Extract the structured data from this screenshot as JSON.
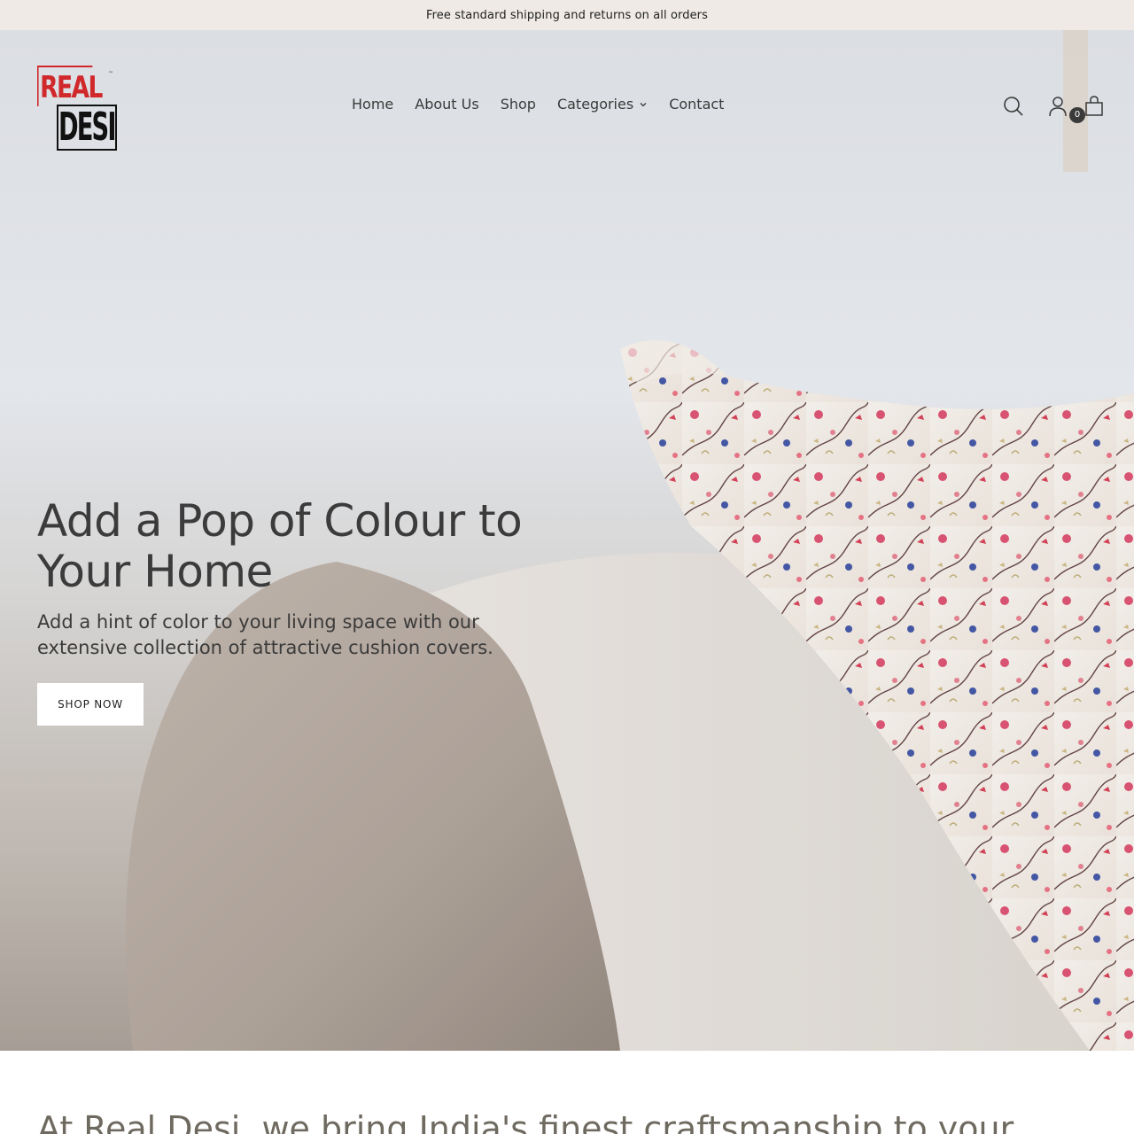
{
  "announcement": {
    "text": "Free standard shipping and returns on all orders"
  },
  "header": {
    "logo": {
      "line1": "REAL",
      "line2": "DESI",
      "mark": "™"
    },
    "nav": [
      {
        "label": "Home"
      },
      {
        "label": "About Us"
      },
      {
        "label": "Shop"
      },
      {
        "label": "Categories",
        "has_dropdown": true
      },
      {
        "label": "Contact"
      }
    ],
    "icons": [
      "search-icon",
      "account-icon",
      "cart-icon"
    ],
    "cart_count": "0"
  },
  "hero": {
    "title": "Add a Pop of Colour to Your Home",
    "subtitle": "Add a hint of color to your living space with our extensive collection of attractive cushion covers.",
    "cta_label": "SHOP NOW"
  },
  "intro": {
    "text": "At Real Desi, we bring India's finest craftsmanship to your"
  },
  "colors": {
    "announcement_bg": "#efeae5",
    "logo_red": "#d0282b",
    "text_dark": "#3b3b3b",
    "intro_text": "#6f6a60"
  }
}
